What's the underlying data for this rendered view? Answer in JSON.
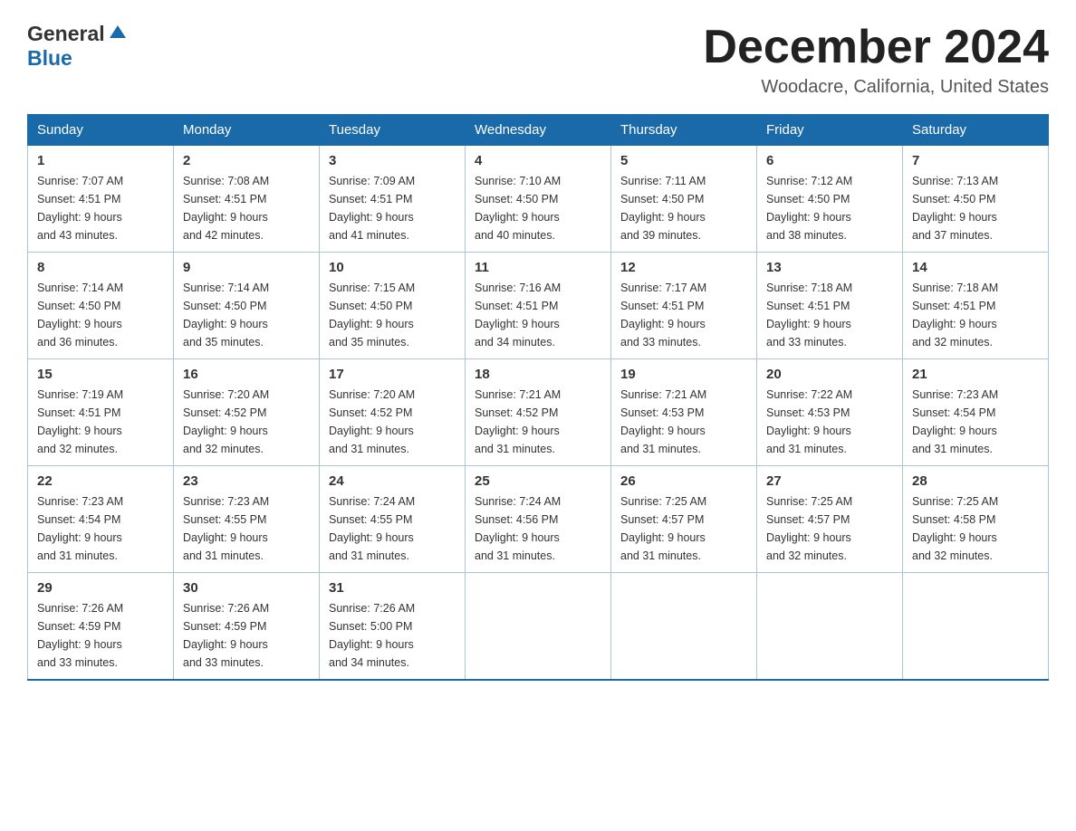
{
  "header": {
    "logo_general": "General",
    "logo_blue": "Blue",
    "month_title": "December 2024",
    "location": "Woodacre, California, United States"
  },
  "days_of_week": [
    "Sunday",
    "Monday",
    "Tuesday",
    "Wednesday",
    "Thursday",
    "Friday",
    "Saturday"
  ],
  "weeks": [
    [
      {
        "num": "1",
        "sunrise": "7:07 AM",
        "sunset": "4:51 PM",
        "daylight": "9 hours and 43 minutes."
      },
      {
        "num": "2",
        "sunrise": "7:08 AM",
        "sunset": "4:51 PM",
        "daylight": "9 hours and 42 minutes."
      },
      {
        "num": "3",
        "sunrise": "7:09 AM",
        "sunset": "4:51 PM",
        "daylight": "9 hours and 41 minutes."
      },
      {
        "num": "4",
        "sunrise": "7:10 AM",
        "sunset": "4:50 PM",
        "daylight": "9 hours and 40 minutes."
      },
      {
        "num": "5",
        "sunrise": "7:11 AM",
        "sunset": "4:50 PM",
        "daylight": "9 hours and 39 minutes."
      },
      {
        "num": "6",
        "sunrise": "7:12 AM",
        "sunset": "4:50 PM",
        "daylight": "9 hours and 38 minutes."
      },
      {
        "num": "7",
        "sunrise": "7:13 AM",
        "sunset": "4:50 PM",
        "daylight": "9 hours and 37 minutes."
      }
    ],
    [
      {
        "num": "8",
        "sunrise": "7:14 AM",
        "sunset": "4:50 PM",
        "daylight": "9 hours and 36 minutes."
      },
      {
        "num": "9",
        "sunrise": "7:14 AM",
        "sunset": "4:50 PM",
        "daylight": "9 hours and 35 minutes."
      },
      {
        "num": "10",
        "sunrise": "7:15 AM",
        "sunset": "4:50 PM",
        "daylight": "9 hours and 35 minutes."
      },
      {
        "num": "11",
        "sunrise": "7:16 AM",
        "sunset": "4:51 PM",
        "daylight": "9 hours and 34 minutes."
      },
      {
        "num": "12",
        "sunrise": "7:17 AM",
        "sunset": "4:51 PM",
        "daylight": "9 hours and 33 minutes."
      },
      {
        "num": "13",
        "sunrise": "7:18 AM",
        "sunset": "4:51 PM",
        "daylight": "9 hours and 33 minutes."
      },
      {
        "num": "14",
        "sunrise": "7:18 AM",
        "sunset": "4:51 PM",
        "daylight": "9 hours and 32 minutes."
      }
    ],
    [
      {
        "num": "15",
        "sunrise": "7:19 AM",
        "sunset": "4:51 PM",
        "daylight": "9 hours and 32 minutes."
      },
      {
        "num": "16",
        "sunrise": "7:20 AM",
        "sunset": "4:52 PM",
        "daylight": "9 hours and 32 minutes."
      },
      {
        "num": "17",
        "sunrise": "7:20 AM",
        "sunset": "4:52 PM",
        "daylight": "9 hours and 31 minutes."
      },
      {
        "num": "18",
        "sunrise": "7:21 AM",
        "sunset": "4:52 PM",
        "daylight": "9 hours and 31 minutes."
      },
      {
        "num": "19",
        "sunrise": "7:21 AM",
        "sunset": "4:53 PM",
        "daylight": "9 hours and 31 minutes."
      },
      {
        "num": "20",
        "sunrise": "7:22 AM",
        "sunset": "4:53 PM",
        "daylight": "9 hours and 31 minutes."
      },
      {
        "num": "21",
        "sunrise": "7:23 AM",
        "sunset": "4:54 PM",
        "daylight": "9 hours and 31 minutes."
      }
    ],
    [
      {
        "num": "22",
        "sunrise": "7:23 AM",
        "sunset": "4:54 PM",
        "daylight": "9 hours and 31 minutes."
      },
      {
        "num": "23",
        "sunrise": "7:23 AM",
        "sunset": "4:55 PM",
        "daylight": "9 hours and 31 minutes."
      },
      {
        "num": "24",
        "sunrise": "7:24 AM",
        "sunset": "4:55 PM",
        "daylight": "9 hours and 31 minutes."
      },
      {
        "num": "25",
        "sunrise": "7:24 AM",
        "sunset": "4:56 PM",
        "daylight": "9 hours and 31 minutes."
      },
      {
        "num": "26",
        "sunrise": "7:25 AM",
        "sunset": "4:57 PM",
        "daylight": "9 hours and 31 minutes."
      },
      {
        "num": "27",
        "sunrise": "7:25 AM",
        "sunset": "4:57 PM",
        "daylight": "9 hours and 32 minutes."
      },
      {
        "num": "28",
        "sunrise": "7:25 AM",
        "sunset": "4:58 PM",
        "daylight": "9 hours and 32 minutes."
      }
    ],
    [
      {
        "num": "29",
        "sunrise": "7:26 AM",
        "sunset": "4:59 PM",
        "daylight": "9 hours and 33 minutes."
      },
      {
        "num": "30",
        "sunrise": "7:26 AM",
        "sunset": "4:59 PM",
        "daylight": "9 hours and 33 minutes."
      },
      {
        "num": "31",
        "sunrise": "7:26 AM",
        "sunset": "5:00 PM",
        "daylight": "9 hours and 34 minutes."
      },
      null,
      null,
      null,
      null
    ]
  ],
  "labels": {
    "sunrise": "Sunrise:",
    "sunset": "Sunset:",
    "daylight": "Daylight:"
  }
}
